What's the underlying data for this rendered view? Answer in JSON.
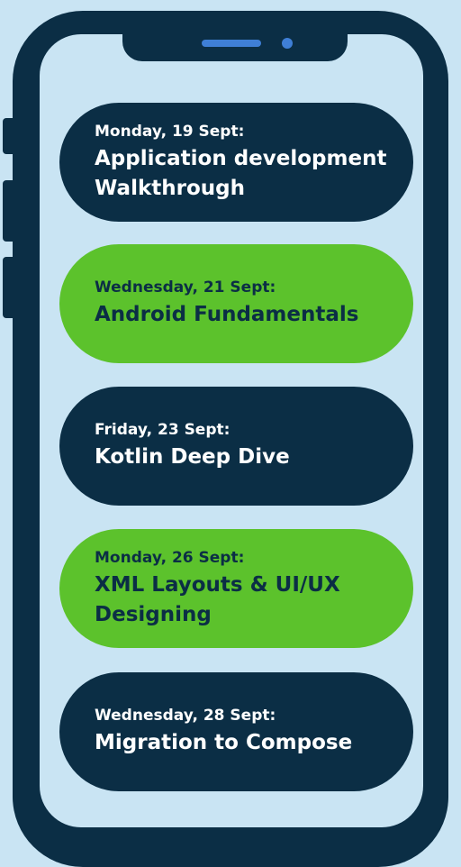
{
  "colors": {
    "background": "#c9e4f3",
    "frame": "#0b2e45",
    "accent_green": "#5cc22c",
    "speaker": "#3f7fd6"
  },
  "sessions": [
    {
      "date": "Monday, 19 Sept:",
      "title_line1": "Application development",
      "title_line2": "Walkthrough",
      "style": "dark"
    },
    {
      "date": "Wednesday, 21 Sept:",
      "title_line1": "Android Fundamentals",
      "style": "green"
    },
    {
      "date": "Friday, 23 Sept:",
      "title_line1": "Kotlin Deep Dive",
      "style": "dark"
    },
    {
      "date": "Monday, 26 Sept:",
      "title_line1": "XML Layouts & UI/UX",
      "title_line2": "Designing",
      "style": "green"
    },
    {
      "date": "Wednesday, 28 Sept:",
      "title_line1": "Migration to Compose",
      "style": "dark"
    }
  ]
}
